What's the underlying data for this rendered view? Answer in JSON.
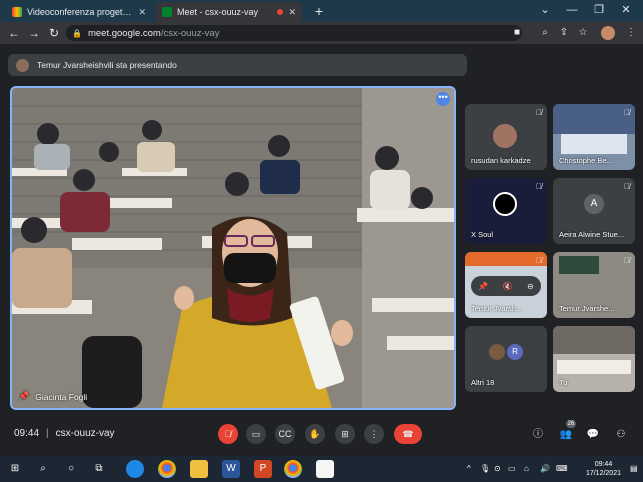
{
  "browser": {
    "tabs": [
      {
        "title": "Videoconferenza progetto intern",
        "active": false,
        "favicon": "gmail-icon"
      },
      {
        "title": "Meet - csx-ouuz-vay",
        "active": true,
        "favicon": "meet-icon",
        "recording": true
      }
    ],
    "new_tab": "+",
    "window": {
      "collapse": "⌄",
      "minimize": "—",
      "restore": "❐",
      "close": "✕"
    },
    "url_host": "meet.google.com",
    "url_path": "/csx-ouuz-vay"
  },
  "banner": {
    "text": "Temur Jvarsheishvili sta presentando"
  },
  "main_video": {
    "speaker": "Giacinta Fogli",
    "more": "•••"
  },
  "tiles": [
    {
      "name": "rusudan karkadze",
      "kind": "avatar-photo",
      "muted": true
    },
    {
      "name": "Christophe Be...",
      "kind": "video",
      "muted": true
    },
    {
      "name": "X Soul",
      "kind": "logo",
      "muted": true
    },
    {
      "name": "Aeira Alwine Stue...",
      "kind": "letter",
      "letter": "A",
      "muted": true
    },
    {
      "name": "Temur Jvarsh...",
      "kind": "video",
      "muted": true
    },
    {
      "name": "Temur Jvarshe...",
      "kind": "video",
      "muted": true
    },
    {
      "name": "Altri 18",
      "kind": "others",
      "letter": "R",
      "muted": false
    },
    {
      "name": "Tu",
      "kind": "video",
      "muted": false
    }
  ],
  "controls": {
    "time": "09:44",
    "separator": "|",
    "meeting_code": "csx-ouuz-vay",
    "participants_count": "26"
  },
  "taskbar": {
    "time": "09:44",
    "date": "17/12/2021"
  },
  "colors": {
    "accent": "#8ab4f8",
    "leave": "#ea4335",
    "muted_mic": "#ea4335",
    "background": "#202124"
  }
}
